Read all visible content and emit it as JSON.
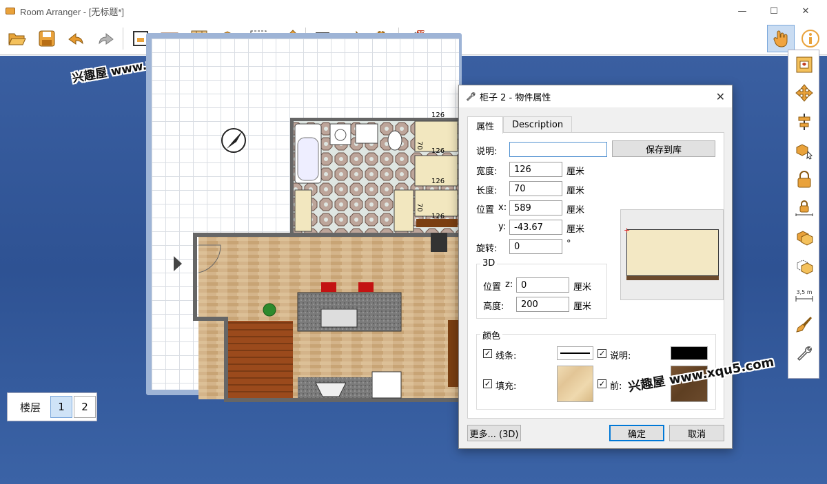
{
  "window": {
    "title": "Room Arranger - [无标题*]",
    "minimize_glyph": "—",
    "maximize_glyph": "☐",
    "close_glyph": "✕"
  },
  "toolbar": {
    "buttons": [
      "open-folder-icon",
      "save-icon",
      "undo-icon",
      "redo-icon",
      "room-icon",
      "wall-icon",
      "floor-pattern-icon",
      "add-object-icon",
      "select-area-icon",
      "pencil-icon",
      "align-icon",
      "export-icon",
      "settings-gear-icon",
      "3d-view-icon",
      "hand-pointer-icon",
      "info-icon"
    ],
    "badge_3d": "3D"
  },
  "watermark": {
    "text": "兴趣屋 www.xqu5.com"
  },
  "plan": {
    "dimensions": [
      "126",
      "70",
      "126",
      "126",
      "70",
      "126"
    ]
  },
  "floors": {
    "label": "楼层",
    "tabs": [
      "1",
      "2"
    ]
  },
  "side_panel": {
    "buttons": [
      "object-library-icon",
      "move-icon",
      "align-center-icon",
      "duplicate-object-icon",
      "lock-icon",
      "lock-dimension-icon",
      "stack-objects-icon",
      "ungroup-icon",
      "measure-icon",
      "paint-brush-icon",
      "wrench-icon"
    ],
    "measure_label": "3,5 m"
  },
  "dialog": {
    "title": "柜子 2 - 物件属性",
    "tabs": [
      "属性",
      "Description"
    ],
    "description_label": "说明:",
    "description_value": "",
    "save_to_library": "保存到库",
    "width_label": "宽度:",
    "width_value": "126",
    "length_label": "长度:",
    "length_value": "70",
    "pos_label": "位置",
    "x_label": "x:",
    "x_value": "589",
    "y_label": "y:",
    "y_value": "-43.67",
    "rotate_label": "旋转:",
    "rotate_value": "0",
    "degree": "°",
    "unit": "厘米",
    "group_3d": "3D",
    "pos_z_label": "位置",
    "z_label": "z:",
    "z_value": "0",
    "height_label": "高度:",
    "height_value": "200",
    "group_color": "颜色",
    "line_label": "线条:",
    "fill_label": "填充:",
    "desc_color_label": "说明:",
    "front_label": "前:",
    "check_glyph": "✓",
    "more_button": "更多... (3D)",
    "ok_button": "确定",
    "cancel_button": "取消",
    "colors": {
      "line": "#000000",
      "fill": "#e8d2a8",
      "description": "#000000",
      "front": "#6b4a2c"
    }
  }
}
